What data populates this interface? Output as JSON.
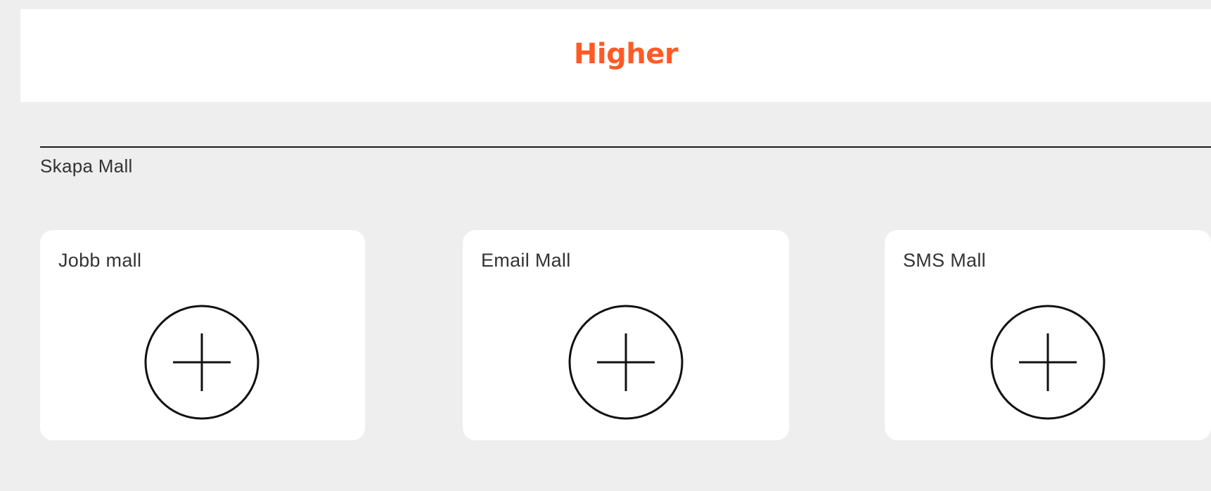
{
  "header": {
    "logo_text": "Higher",
    "logo_color": "#ff5a26"
  },
  "section": {
    "title": "Skapa Mall"
  },
  "cards": [
    {
      "label": "Jobb mall",
      "icon": "plus-circle-icon"
    },
    {
      "label": "Email Mall",
      "icon": "plus-circle-icon"
    },
    {
      "label": "SMS Mall",
      "icon": "plus-circle-icon"
    }
  ]
}
